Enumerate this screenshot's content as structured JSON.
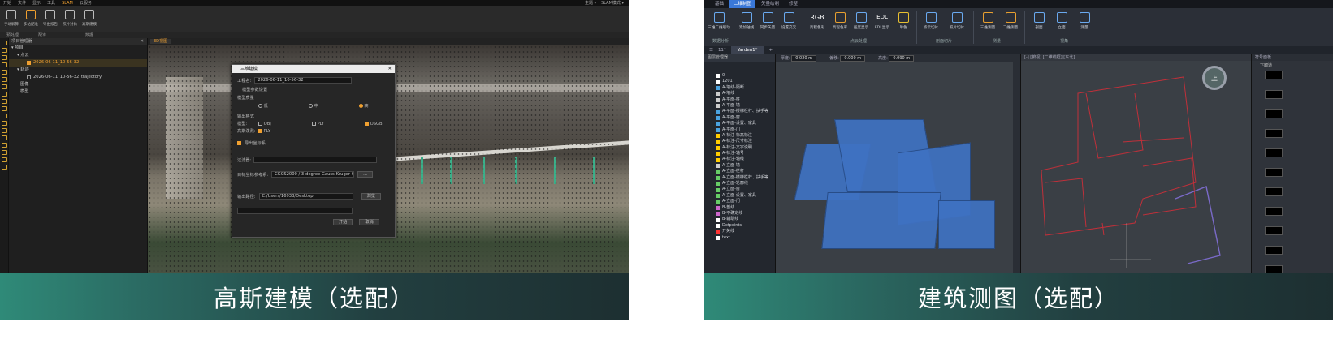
{
  "left": {
    "menu": [
      "开始",
      "文件",
      "显示",
      "工具",
      "SLAM",
      "云服务"
    ],
    "menu_active": "SLAM",
    "menu_right": [
      "主题 ▾",
      "SLAM模式 ▾"
    ],
    "ribbon": [
      "手动解算",
      "多站配准",
      "导出报告",
      "照片对比",
      "高斯建模"
    ],
    "groups": [
      "预处理",
      "配准",
      "数据"
    ],
    "tree_header": "项目管理器",
    "tree_rows": [
      "项目",
      "点云",
      "2026-06-11_10-56-32",
      "轨迹",
      "2026-06-11_10-56-32_trajectory",
      "图像",
      "模型"
    ],
    "view_tab": "3D视图",
    "dialog": {
      "title": "三维建模",
      "project_label": "工程名:",
      "project_value": "2026-06-11_10-56-32",
      "param_label": "模型参数设置",
      "quality_label": "模型质量",
      "q_low": "低",
      "q_mid": "中",
      "q_high": "高",
      "output_label": "输出格式",
      "model_label": "模型:",
      "fmt_obj": "OBJ",
      "fmt_ply": "PLY",
      "fmt_osgb": "OSGB",
      "gauss_label": "高斯泼溅:",
      "gauss_fmt": "PLY",
      "coord_check": "导出坐标系",
      "filter_label": "过滤器:",
      "coord_label": "目标坐标参考系:",
      "coord_value": "CGCS2000 / 3-degree Gauss-Kruger CM 111E",
      "coord_btn": "...",
      "path_label": "输出路径:",
      "path_value": "C:/Users/16933/Desktop",
      "browse": "浏览",
      "start": "开始",
      "cancel": "取消"
    },
    "caption": "高斯建模（选配）"
  },
  "right": {
    "menu": [
      "基础",
      "二维制图",
      "矢量绘制",
      "修整"
    ],
    "menu_active": "二维制图",
    "ribbon": [
      "三维二维联动",
      "添加轴线",
      "同步矢量",
      "设置交叉",
      "RGB",
      "高程色彩",
      "强度显示",
      "EDL",
      "EDL显示",
      "单色",
      "点云切片",
      "照片切片",
      "正射影像",
      "三维测量",
      "二维测量",
      "剖面",
      "立面",
      "测量"
    ],
    "groups": [
      "数据分析",
      "点云处理",
      "剖面切片",
      "测量",
      "视角"
    ],
    "tab_label": "Yarden1*",
    "tab_label2": "11*",
    "layer_header": "图层管理器",
    "layers": [
      {
        "name": "0",
        "color": "#ffffff"
      },
      {
        "name": "1201",
        "color": "#ffffff"
      },
      {
        "name": "A-墙线-隔断",
        "color": "#4aa3e0"
      },
      {
        "name": "A-墙线",
        "color": "#cccccc"
      },
      {
        "name": "A-平面-柱",
        "color": "#cccccc"
      },
      {
        "name": "A-平面-墙",
        "color": "#cccccc"
      },
      {
        "name": "A-平面-楼梯栏杆、扶手等",
        "color": "#4aa3e0"
      },
      {
        "name": "A-平面-窗",
        "color": "#4aa3e0"
      },
      {
        "name": "A-平面-设置、家具",
        "color": "#4aa3e0"
      },
      {
        "name": "A-平面-门",
        "color": "#4aa3e0"
      },
      {
        "name": "A-标注-标高标注",
        "color": "#ffcc00"
      },
      {
        "name": "A-标注-尺寸标注",
        "color": "#ffcc00"
      },
      {
        "name": "A-标注-文字说明",
        "color": "#ffcc00"
      },
      {
        "name": "A-标注-轴号",
        "color": "#ffcc00"
      },
      {
        "name": "A-标注-轴线",
        "color": "#ffcc00"
      },
      {
        "name": "A-立面-墙",
        "color": "#cccccc"
      },
      {
        "name": "A-立面-栏杆",
        "color": "#66cc66"
      },
      {
        "name": "A-立面-楼梯栏杆、扶手等",
        "color": "#66cc66"
      },
      {
        "name": "A-立面-轮廓线",
        "color": "#66cc66"
      },
      {
        "name": "A-立面-窗",
        "color": "#66cc66"
      },
      {
        "name": "A-立面-设置、家具",
        "color": "#66cc66"
      },
      {
        "name": "A-立面-门",
        "color": "#66cc66"
      },
      {
        "name": "B-剖线",
        "color": "#cc66cc"
      },
      {
        "name": "B-不确定线",
        "color": "#cc66cc"
      },
      {
        "name": "B-辅助线",
        "color": "#ffffff"
      },
      {
        "name": "Defpoints",
        "color": "#ffffff"
      },
      {
        "name": "开关线",
        "color": "#ff3333"
      },
      {
        "name": "text",
        "color": "#ffffff"
      }
    ],
    "view_toolbar": {
      "thickness_label": "厚度:",
      "thickness": "0.020 m",
      "offset_label": "偏移:",
      "offset": "0.000 m",
      "height_label": "高度:",
      "height": "0.090 m"
    },
    "plan_header": "[-] [俯视] [二维线框] [东北]",
    "compass": "上",
    "prop_header": "符号面板",
    "prop_title": "下廊道",
    "caption": "建筑测图（选配）"
  }
}
